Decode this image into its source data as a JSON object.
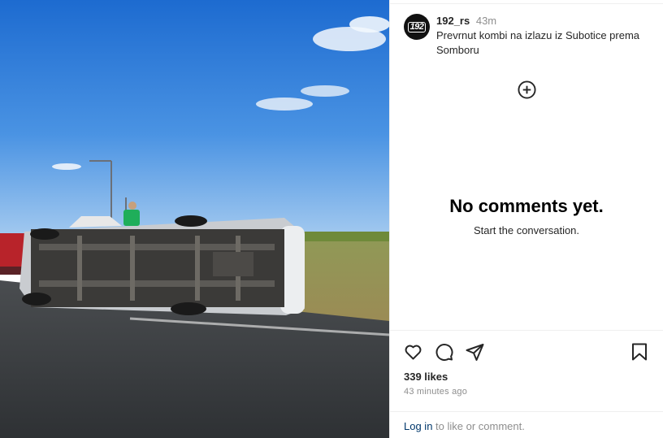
{
  "post": {
    "username": "192_rs",
    "time_ago": "43m",
    "avatar_text": "192",
    "caption": "Prevrnut kombi na izlazu iz Subotice prema Somboru"
  },
  "comments": {
    "empty_title": "No comments yet.",
    "empty_subtitle": "Start the conversation."
  },
  "footer": {
    "likes": "339 likes",
    "posted": "43 minutes ago",
    "login_link": "Log in",
    "login_suffix": " to like or comment."
  },
  "icons": {
    "like": "heart-icon",
    "comment": "comment-icon",
    "share": "share-icon",
    "save": "bookmark-icon",
    "add": "plus-circle-icon"
  },
  "colors": {
    "sky_top": "#1f6fd1",
    "sky_bottom": "#7fb4ea",
    "link": "#00376b",
    "muted": "#8e8e8e"
  }
}
